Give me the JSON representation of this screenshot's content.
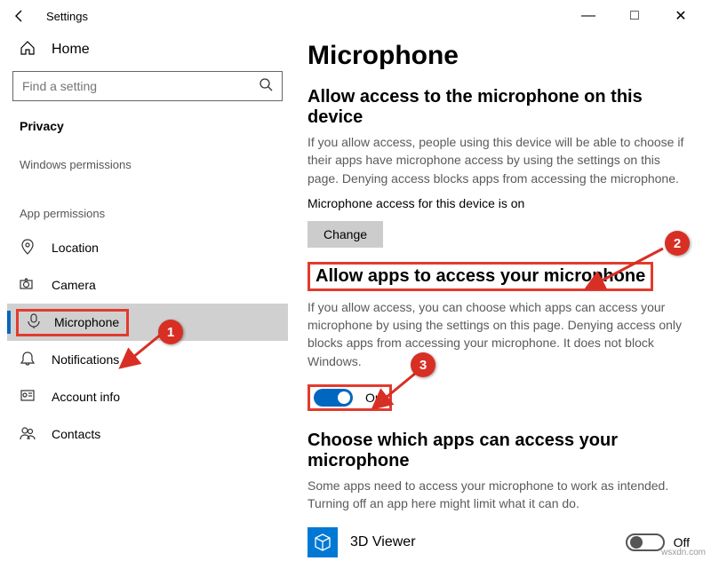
{
  "window": {
    "back_icon": "←",
    "title": "Settings",
    "minimize": "—",
    "maximize": "□",
    "close": "✕"
  },
  "sidebar": {
    "home_label": "Home",
    "search_placeholder": "Find a setting",
    "category": "Privacy",
    "section_windows": "Windows permissions",
    "section_app": "App permissions",
    "items": {
      "location": "Location",
      "camera": "Camera",
      "microphone": "Microphone",
      "notifications": "Notifications",
      "account": "Account info",
      "contacts": "Contacts"
    }
  },
  "main": {
    "title": "Microphone",
    "allow_device_heading": "Allow access to the microphone on this device",
    "allow_device_desc": "If you allow access, people using this device will be able to choose if their apps have microphone access by using the settings on this page. Denying access blocks apps from accessing the microphone.",
    "status_line": "Microphone access for this device is on",
    "change_btn": "Change",
    "allow_apps_heading": "Allow apps to access your microphone",
    "allow_apps_desc": "If you allow access, you can choose which apps can access your microphone by using the settings on this page. Denying access only blocks apps from accessing your microphone. It does not block Windows.",
    "toggle_on": "On",
    "choose_apps_heading": "Choose which apps can access your microphone",
    "choose_apps_desc": "Some apps need to access your microphone to work as intended. Turning off an app here might limit what it can do.",
    "app1_name": "3D Viewer",
    "app1_state": "Off"
  },
  "annotations": {
    "b1": "1",
    "b2": "2",
    "b3": "3"
  },
  "watermark": "wsxdn.com"
}
